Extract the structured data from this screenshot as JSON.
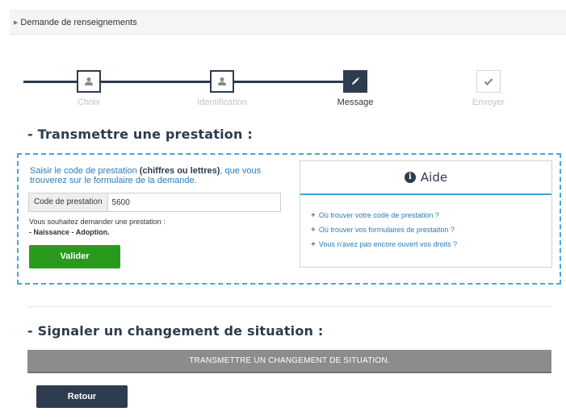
{
  "breadcrumb": {
    "label": "Demande de renseignements",
    "icon": "caret-right-icon"
  },
  "stepper": {
    "steps": [
      {
        "label": "Choix",
        "icon": "user-icon",
        "state": "done"
      },
      {
        "label": "Identification",
        "icon": "user-icon",
        "state": "done"
      },
      {
        "label": "Message",
        "icon": "pencil-icon",
        "state": "active"
      },
      {
        "label": "Envoyer",
        "icon": "check-icon",
        "state": "disabled"
      }
    ]
  },
  "transmettre": {
    "title": "- Transmettre une prestation :",
    "intro_before": "Saisir le code de prestation ",
    "intro_bold": "(chiffres ou lettres)",
    "intro_after": ", que vous trouverez sur le formulaire de la demande.",
    "code_label": "Code de prestation",
    "code_value": "5600",
    "note_line1": "Vous souhaitez demander une prestation :",
    "note_line2": "- Naissance - Adoption.",
    "submit_label": "Valider"
  },
  "aide": {
    "title": "Aide",
    "icon": "info-icon",
    "links": [
      "Où trouver votre code de prestation ?",
      "Où trouver vos formulaires de prestaiton ?",
      "Vous n'avez pas encore ouvert vos droits ?"
    ]
  },
  "changement": {
    "title": "- Signaler un changement de situation :",
    "button_label": "TRANSMETTRE UN CHANGEMENT DE SITUATION."
  },
  "back_label": "Retour",
  "colors": {
    "primary_dark": "#2e3c50",
    "accent_blue": "#3ea2d8",
    "link_blue": "#2b7bb9",
    "success_green": "#2a9a1e",
    "neutral_gray": "#8c8c8c"
  }
}
